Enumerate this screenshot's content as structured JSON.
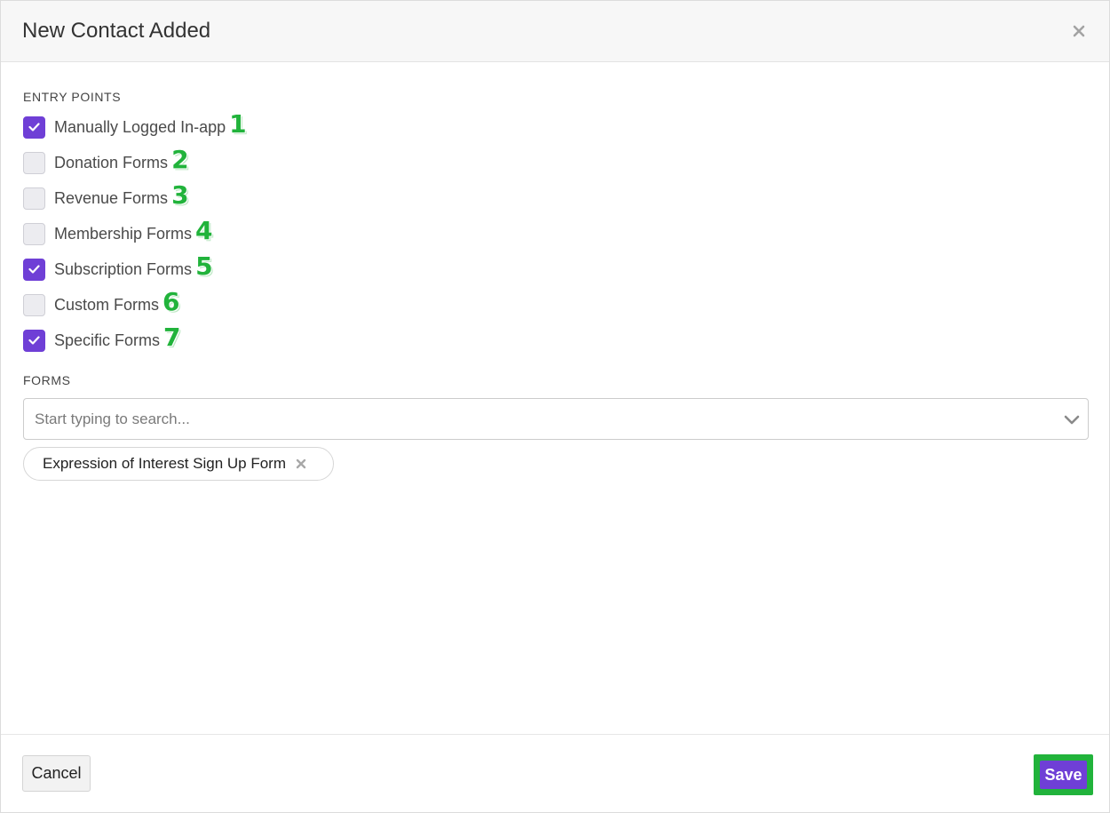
{
  "modal": {
    "title": "New Contact Added"
  },
  "entry_points": {
    "label": "ENTRY POINTS",
    "options": [
      {
        "label": "Manually Logged In-app",
        "checked": true,
        "marker": "1"
      },
      {
        "label": "Donation Forms",
        "checked": false,
        "marker": "2"
      },
      {
        "label": "Revenue Forms",
        "checked": false,
        "marker": "3"
      },
      {
        "label": "Membership Forms",
        "checked": false,
        "marker": "4"
      },
      {
        "label": "Subscription Forms",
        "checked": true,
        "marker": "5"
      },
      {
        "label": "Custom Forms",
        "checked": false,
        "marker": "6"
      },
      {
        "label": "Specific Forms",
        "checked": true,
        "marker": "7"
      }
    ]
  },
  "forms": {
    "label": "FORMS",
    "search_placeholder": "Start typing to search...",
    "search_value": "",
    "selected": [
      {
        "label": "Expression of Interest Sign Up Form"
      }
    ]
  },
  "footer": {
    "cancel_label": "Cancel",
    "save_label": "Save"
  },
  "colors": {
    "accent": "#6f3fd6",
    "marker": "#21b33b"
  },
  "icons": {
    "close": "close-icon",
    "check": "check-icon",
    "chevron": "chevron-down-icon",
    "chip_remove": "close-icon"
  }
}
